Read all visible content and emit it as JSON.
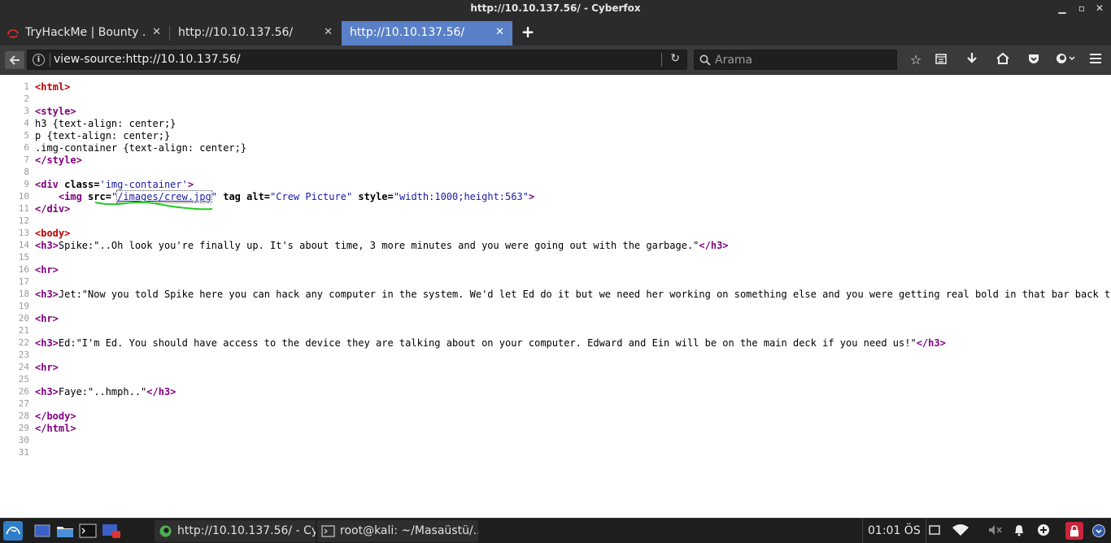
{
  "window": {
    "title": "http://10.10.137.56/ - Cyberfox"
  },
  "tabs": [
    {
      "label": "TryHackMe | Bounty ...",
      "close": "✕",
      "active": false
    },
    {
      "label": "http://10.10.137.56/",
      "close": "✕",
      "active": false
    },
    {
      "label": "http://10.10.137.56/",
      "close": "✕",
      "active": true
    }
  ],
  "new_tab": "+",
  "navbar": {
    "url": "view-source:http://10.10.137.56/",
    "search_placeholder": "Arama"
  },
  "source_lines": [
    "1",
    "2",
    "3",
    "4",
    "5",
    "6",
    "7",
    "8",
    "9",
    "10",
    "11",
    "12",
    "13",
    "14",
    "15",
    "16",
    "17",
    "18",
    "19",
    "20",
    "21",
    "22",
    "23",
    "24",
    "25",
    "26",
    "27",
    "28",
    "29",
    "30",
    "31"
  ],
  "source": {
    "l1_tag": "<html>",
    "l3_tag": "<style>",
    "l4": "h3 {text-align: center;}",
    "l5": "p {text-align: center;}",
    "l6": ".img-container {text-align: center;}",
    "l7_tag": "</style>",
    "l9_open": "<div",
    "l9_attr": " class=",
    "l9_val": "'img-container'",
    "l9_close": ">",
    "l10_indent": "    ",
    "l10_open": "<img",
    "l10_src": " src=",
    "l10_q1": "\"",
    "l10_link": "/images/crew.jpg",
    "l10_q2": "\"",
    "l10_tag": " tag",
    "l10_alt": " alt=",
    "l10_altv": "\"Crew Picture\"",
    "l10_style": " style=",
    "l10_stylev": "\"width:1000;height:563\"",
    "l10_close": ">",
    "l11_tag": "</div>",
    "l13_tag": "<body>",
    "l14_open": "<h3>",
    "l14_text": "Spike:\"..Oh look you're finally up. It's about time, 3 more minutes and you were going out with the garbage.\"",
    "l14_close": "</h3>",
    "l16_tag": "<hr>",
    "l18_open": "<h3>",
    "l18_text": "Jet:\"Now you told Spike here you can hack any computer in the system. We'd let Ed do it but we need her working on something else and you were getting real bold in that bar back there. Now show me",
    "l20_tag": "<hr>",
    "l22_open": "<h3>",
    "l22_text": "Ed:\"I'm Ed. You should have access to the device they are talking about on your computer. Edward and Ein will be on the main deck if you need us!\"",
    "l22_close": "</h3>",
    "l24_tag": "<hr>",
    "l26_open": "<h3>",
    "l26_text": "Faye:\"..hmph..\"",
    "l26_close": "</h3>",
    "l28_tag": "</body>",
    "l29_tag": "</html>"
  },
  "taskbar": {
    "tasks": [
      {
        "label": "http://10.10.137.56/ - Cy..."
      },
      {
        "label": "root@kali: ~/Masaüstü/..."
      }
    ],
    "clock": "01:01 ÖS"
  },
  "colors": {
    "accent": "#5a80c8",
    "tag_red": "#c00000",
    "tag_purple": "#800080",
    "attr_value": "#1a1aa6",
    "annotation": "#22cc22"
  }
}
